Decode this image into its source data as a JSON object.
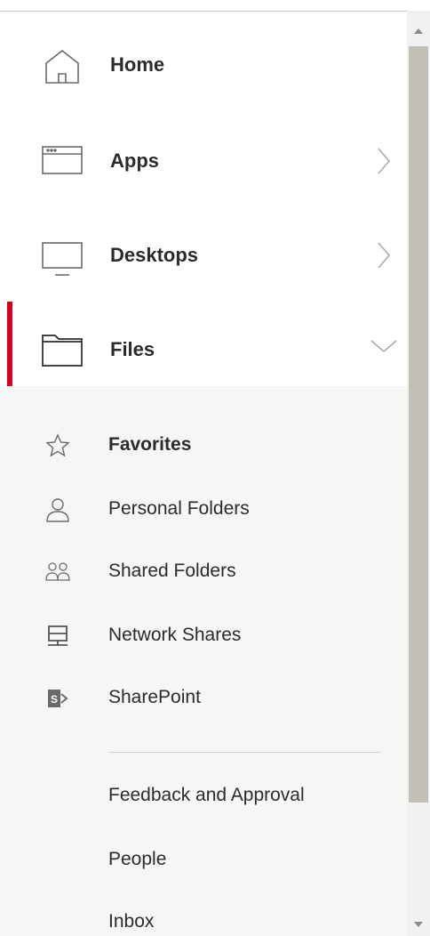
{
  "nav": {
    "items": [
      {
        "label": "Home",
        "icon": "home-icon"
      },
      {
        "label": "Apps",
        "icon": "apps-window-icon",
        "chevron": "chevron-right-icon"
      },
      {
        "label": "Desktops",
        "icon": "monitor-icon",
        "chevron": "chevron-right-icon"
      },
      {
        "label": "Files",
        "icon": "folder-icon",
        "chevron": "chevron-down-icon",
        "active": true
      }
    ],
    "accent_color": "#d6001c"
  },
  "files_submenu": {
    "items": [
      {
        "label": "Favorites",
        "icon": "star-icon",
        "selected": true
      },
      {
        "label": "Personal Folders",
        "icon": "person-icon"
      },
      {
        "label": "Shared Folders",
        "icon": "people-icon"
      },
      {
        "label": "Network Shares",
        "icon": "network-share-icon"
      },
      {
        "label": "SharePoint",
        "icon": "sharepoint-icon"
      }
    ],
    "background_color": "#f7f6f4"
  },
  "extra_items": [
    {
      "label": "Feedback and Approval"
    },
    {
      "label": "People"
    },
    {
      "label": "Inbox"
    }
  ]
}
